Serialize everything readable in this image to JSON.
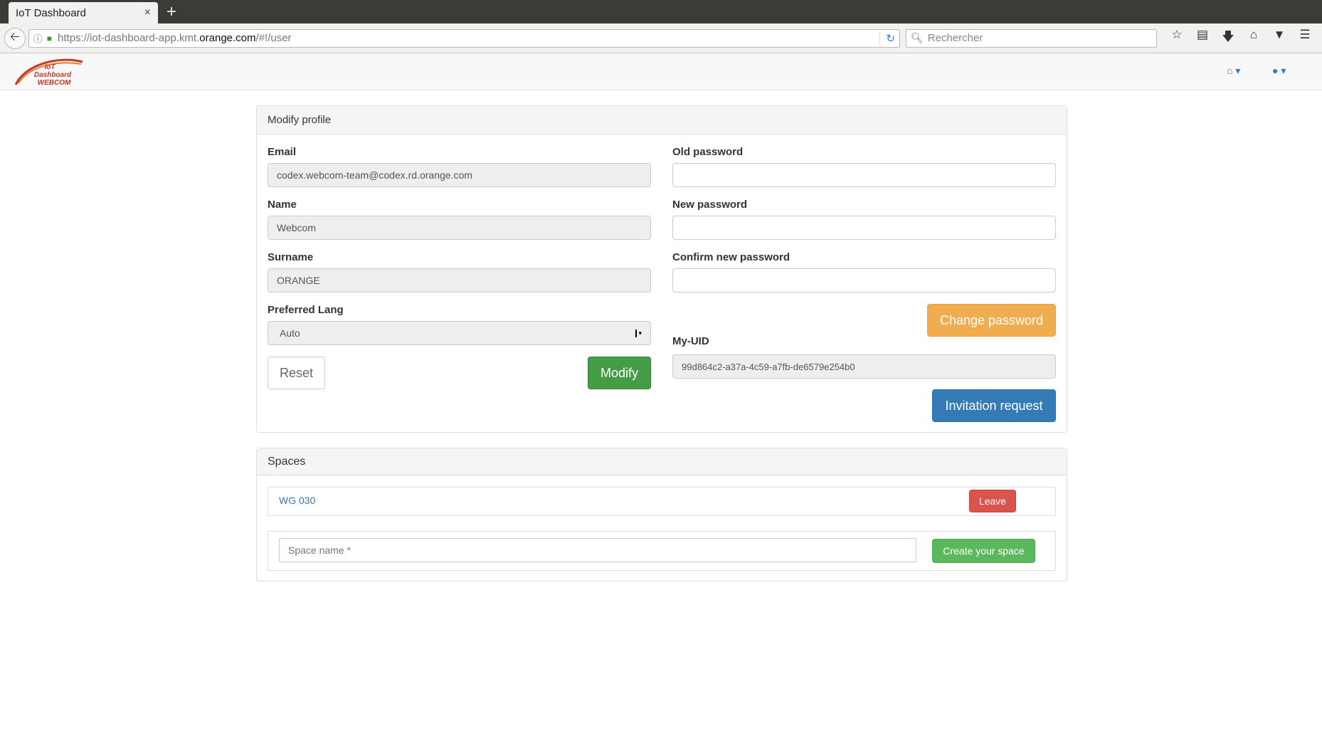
{
  "browser": {
    "tab_title": "IoT Dashboard",
    "tab_close": "×",
    "new_tab": "+",
    "url_prefix": "https://iot-dashboard-app.kmt.",
    "url_domain": "orange.com",
    "url_suffix": "/#!/user",
    "search_placeholder": "Rechercher"
  },
  "app": {
    "logo_line1": "IoT",
    "logo_line2": "Dashboard",
    "logo_line3": "WEBCOM"
  },
  "profile": {
    "heading": "Modify profile",
    "email_label": "Email",
    "email_value": "codex.webcom-team@codex.rd.orange.com",
    "name_label": "Name",
    "name_value": "Webcom",
    "surname_label": "Surname",
    "surname_value": "ORANGE",
    "lang_label": "Preferred Lang",
    "lang_value": "Auto",
    "reset_label": "Reset",
    "modify_label": "Modify",
    "old_password_label": "Old password",
    "new_password_label": "New password",
    "confirm_password_label": "Confirm new password",
    "change_password_label": "Change password",
    "uid_label": "My-UID",
    "uid_value": "99d864c2-a37a-4c59-a7fb-de6579e254b0",
    "invitation_label": "Invitation request"
  },
  "spaces": {
    "heading": "Spaces",
    "items": [
      {
        "name": "WG 030",
        "leave_label": "Leave"
      }
    ],
    "space_name_placeholder": "Space name *",
    "create_label": "Create your space"
  },
  "colors": {
    "link": "#337ab7",
    "success": "#449d44",
    "success_light": "#5cb85c",
    "warning": "#f0ad4e",
    "primary": "#337ab7",
    "danger": "#d9534f"
  }
}
